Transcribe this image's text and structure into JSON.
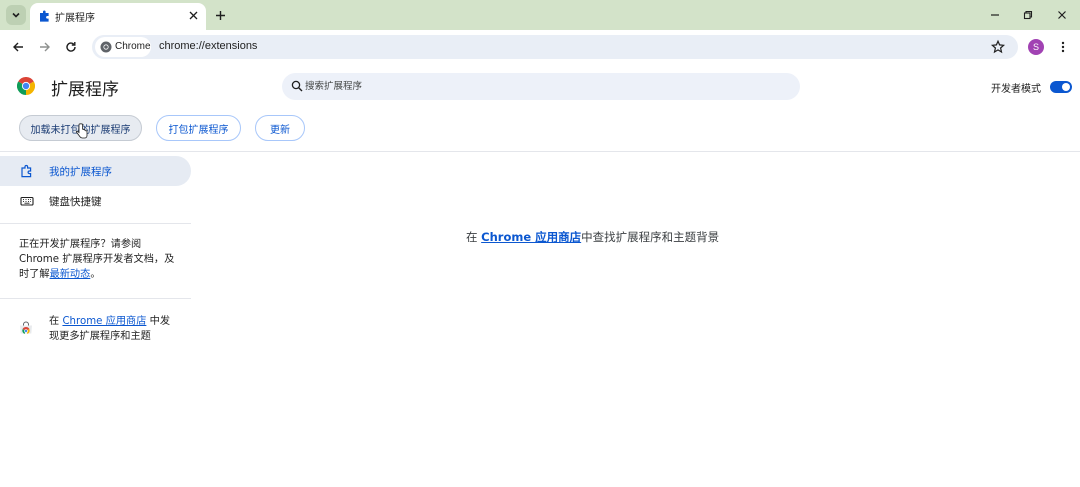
{
  "browser": {
    "tab": {
      "title": "扩展程序",
      "favicon": "puzzle-icon"
    },
    "window_controls": [
      "minimize-icon",
      "restore-icon",
      "close-icon"
    ],
    "omnibox": {
      "chip_label": "Chrome",
      "url": "chrome://extensions"
    },
    "profile_initial": "S"
  },
  "header": {
    "title": "扩展程序",
    "search_placeholder": "搜索扩展程序",
    "dev_mode_label": "开发者模式",
    "dev_mode_on": true,
    "buttons": {
      "load_unpacked": "加载未打包的扩展程序",
      "pack": "打包扩展程序",
      "update": "更新"
    }
  },
  "sidebar": {
    "items": [
      {
        "label": "我的扩展程序",
        "icon": "puzzle-icon",
        "active": true
      },
      {
        "label": "键盘快捷键",
        "icon": "keyboard-icon",
        "active": false
      }
    ],
    "dev_note": {
      "prefix": "正在开发扩展程序？请参阅 Chrome 扩展程序开发者文档，及时了解",
      "link": "最新动态",
      "suffix": "。"
    },
    "store_promo": {
      "prefix": "在 ",
      "link": "Chrome 应用商店",
      "suffix": " 中发现更多扩展程序和主题"
    }
  },
  "main": {
    "prefix": "在 ",
    "link": "Chrome 应用商店",
    "suffix": "中查找扩展程序和主题背景"
  },
  "colors": {
    "tabstrip_bg": "#d3e3c9",
    "accent": "#0b57d0",
    "avatar": "#a142b3"
  }
}
